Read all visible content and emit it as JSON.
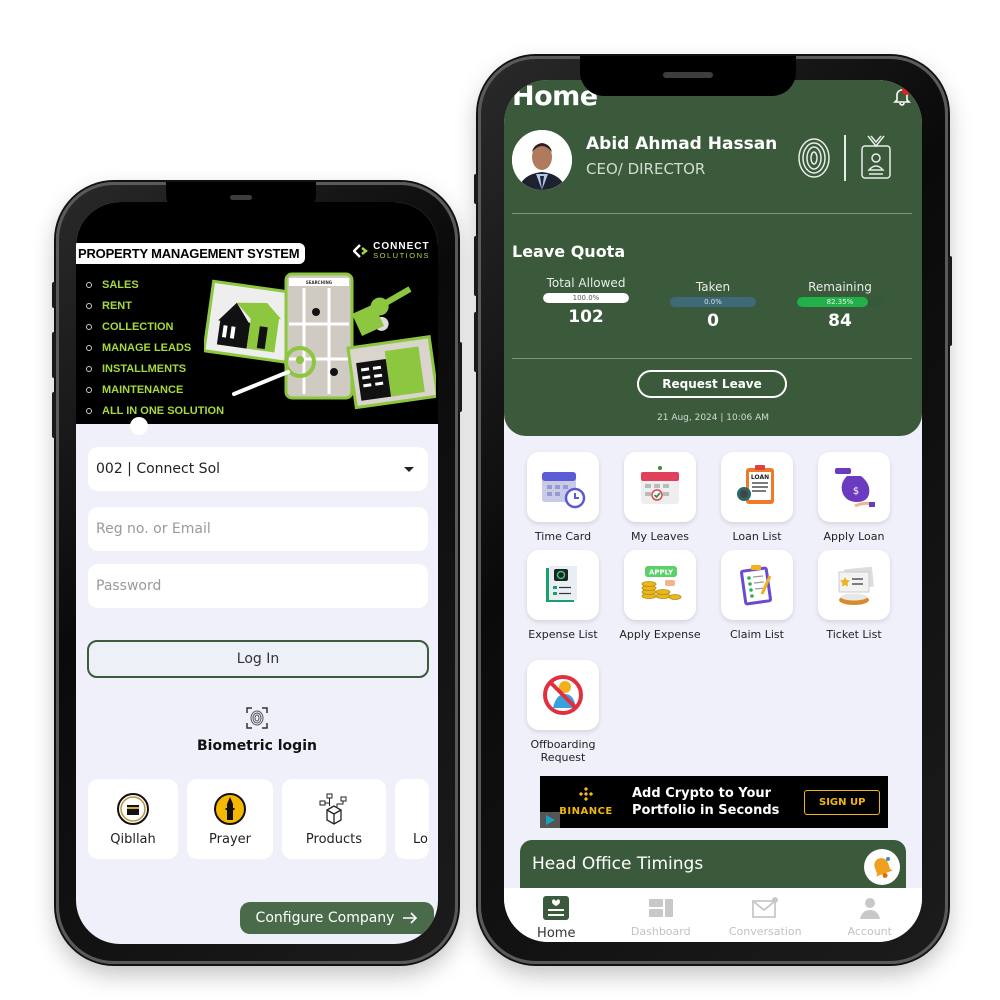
{
  "left_phone": {
    "banner": {
      "title": "PROPERTY MANAGEMENT SYSTEM",
      "brand_line1": "CONNECT",
      "brand_line2": "SOLUTIONS",
      "features": [
        "SALES",
        "RENT",
        "COLLECTION",
        "MANAGE LEADS",
        "INSTALLMENTS",
        "MAINTENANCE",
        "ALL IN ONE SOLUTION"
      ],
      "illustration_label": "SEARCHING"
    },
    "company_select": {
      "value": "002 | Connect Sol"
    },
    "reg_field": {
      "value": "",
      "placeholder": "Reg no. or Email"
    },
    "password_field": {
      "value": "",
      "placeholder": "Password"
    },
    "login_button": "Log In",
    "biometric_label": "Biometric login",
    "quick_tiles": [
      "Qibllah",
      "Prayer",
      "Products",
      "Lo"
    ],
    "configure_button": "Configure Company",
    "accent_color": "#4a6b4a"
  },
  "right_phone": {
    "header": {
      "title": "Home"
    },
    "user": {
      "name": "Abid Ahmad Hassan",
      "role": "CEO/ DIRECTOR"
    },
    "leave_quota": {
      "title": "Leave Quota",
      "stats": [
        {
          "label": "Total Allowed",
          "percent_label": "100.0%",
          "fraction": 1.0,
          "value": "102"
        },
        {
          "label": "Taken",
          "percent_label": "0.0%",
          "fraction": 0.0,
          "value": "0"
        },
        {
          "label": "Remaining",
          "percent_label": "82.35%",
          "fraction": 0.8235,
          "value": "84"
        }
      ],
      "request_button": "Request Leave",
      "timestamp": "21 Aug, 2024  |  10:06 AM"
    },
    "tiles": [
      {
        "label": "Time Card",
        "icon": "calendar-clock-icon"
      },
      {
        "label": "My Leaves",
        "icon": "calendar-check-icon"
      },
      {
        "label": "Loan List",
        "icon": "loan-document-icon"
      },
      {
        "label": "Apply Loan",
        "icon": "money-bag-icon"
      },
      {
        "label": "Expense List",
        "icon": "expense-document-icon"
      },
      {
        "label": "Apply Expense",
        "icon": "apply-coins-icon"
      },
      {
        "label": "Claim List",
        "icon": "clipboard-checklist-icon"
      },
      {
        "label": "Ticket List",
        "icon": "ticket-icon"
      },
      {
        "label": "Offboarding Request",
        "icon": "person-prohibited-icon"
      }
    ],
    "ad": {
      "brand": "BINANCE",
      "message_line1": "Add Crypto to Your",
      "message_line2": "Portfolio in Seconds",
      "cta": "SIGN UP"
    },
    "head_office": {
      "title": "Head Office Timings"
    },
    "bottom_nav": [
      {
        "label": "Home",
        "active": true
      },
      {
        "label": "Dashboard",
        "active": false
      },
      {
        "label": "Conversation",
        "active": false
      },
      {
        "label": "Account",
        "active": false
      }
    ],
    "colors": {
      "primary_green": "#3b5a3c",
      "remaining_bar": "#22b04a",
      "taken_bar": "#3e6a78",
      "binance_gold": "#f0b90b"
    }
  }
}
